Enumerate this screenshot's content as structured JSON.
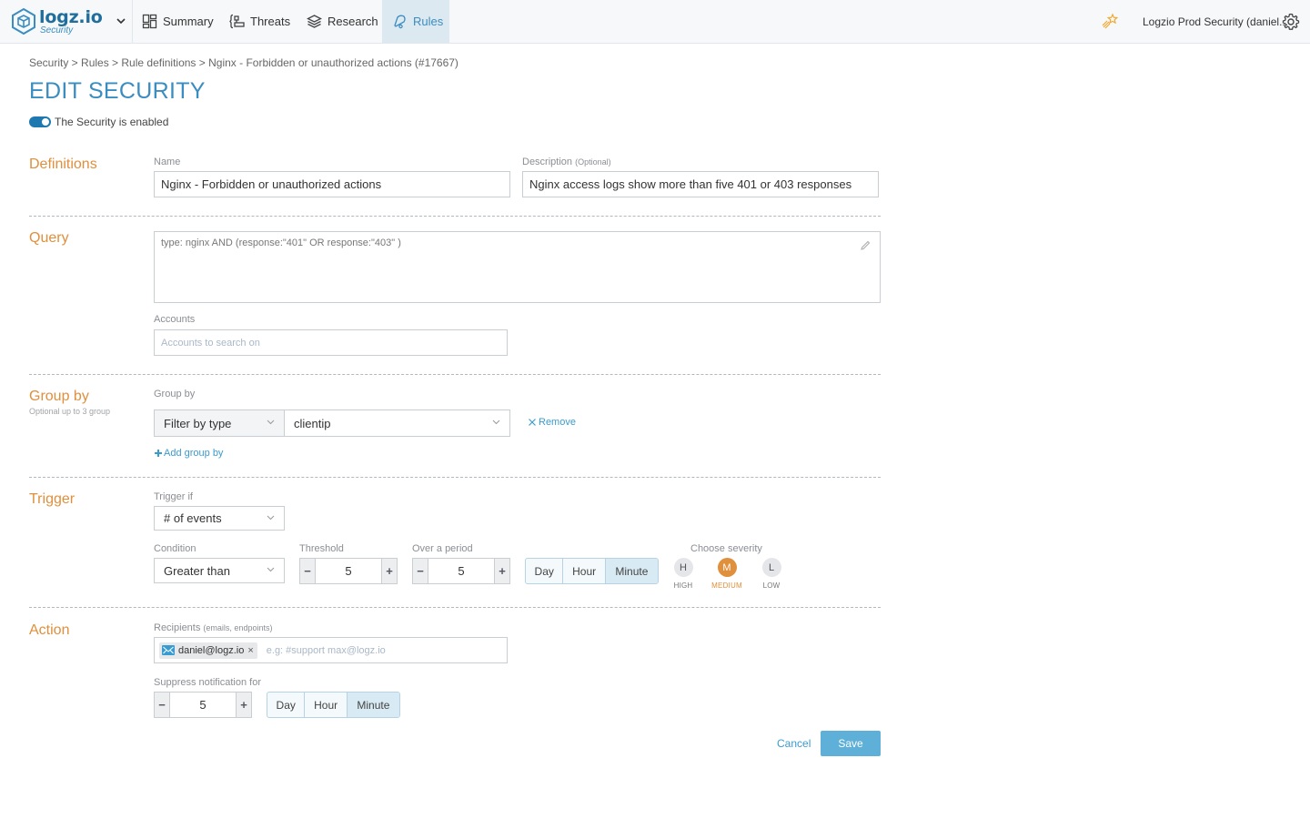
{
  "app": {
    "logo_text": "logz.io",
    "logo_subtext": "Security",
    "account_name": "Logzio Prod Security (daniel..."
  },
  "nav": {
    "items": [
      {
        "label": "Summary",
        "icon": "dashboard-icon",
        "active": false
      },
      {
        "label": "Threats",
        "icon": "threats-icon",
        "active": false
      },
      {
        "label": "Research",
        "icon": "layers-icon",
        "active": false
      },
      {
        "label": "Rules",
        "icon": "bell-icon",
        "active": true
      }
    ]
  },
  "breadcrumb": "Security > Rules > Rule definitions > Nginx - Forbidden or unauthorized actions (#17667)",
  "page_title": "EDIT SECURITY",
  "enabled": {
    "label": "The Security is enabled",
    "on": true
  },
  "colors": {
    "accent": "#3a8dc0",
    "section": "#e08f3c",
    "save": "#5fb0d8",
    "severity_active": "#e08f3c"
  },
  "definitions": {
    "title": "Definitions",
    "name_label": "Name",
    "name_value": "Nginx - Forbidden or unauthorized actions",
    "description_label": "Description",
    "description_optional": "(Optional)",
    "description_value": "Nginx access logs show more than five 401 or 403 responses"
  },
  "query": {
    "title": "Query",
    "value": "type: nginx AND  (response:\"401\" OR response:\"403\" )",
    "accounts_label": "Accounts",
    "accounts_placeholder": "Accounts to search on"
  },
  "group_by": {
    "title": "Group by",
    "subtitle": "Optional up to 3 group",
    "label": "Group by",
    "filter_select": "Filter by type",
    "field_select": "clientip",
    "remove_label": "Remove",
    "add_label": "Add group by"
  },
  "trigger": {
    "title": "Trigger",
    "trigger_if_label": "Trigger if",
    "trigger_if_value": "# of events",
    "condition_label": "Condition",
    "condition_value": "Greater than",
    "threshold_label": "Threshold",
    "threshold_value": "5",
    "period_label": "Over a period",
    "period_value": "5",
    "period_units": [
      {
        "label": "Day",
        "active": false
      },
      {
        "label": "Hour",
        "active": false
      },
      {
        "label": "Minute",
        "active": true
      }
    ],
    "severity_label": "Choose severity",
    "severities": [
      {
        "letter": "H",
        "label": "HIGH",
        "active": false
      },
      {
        "letter": "M",
        "label": "MEDIUM",
        "active": true
      },
      {
        "letter": "L",
        "label": "LOW",
        "active": false
      }
    ]
  },
  "action": {
    "title": "Action",
    "recipients_label": "Recipients",
    "recipients_hint": "(emails, endpoints)",
    "recipients": [
      "daniel@logz.io"
    ],
    "recipients_placeholder": "e.g:  #support  max@logz.io",
    "suppress_label": "Suppress notification for",
    "suppress_value": "5",
    "suppress_units": [
      {
        "label": "Day",
        "active": false
      },
      {
        "label": "Hour",
        "active": false
      },
      {
        "label": "Minute",
        "active": true
      }
    ]
  },
  "footer": {
    "cancel_label": "Cancel",
    "save_label": "Save"
  }
}
